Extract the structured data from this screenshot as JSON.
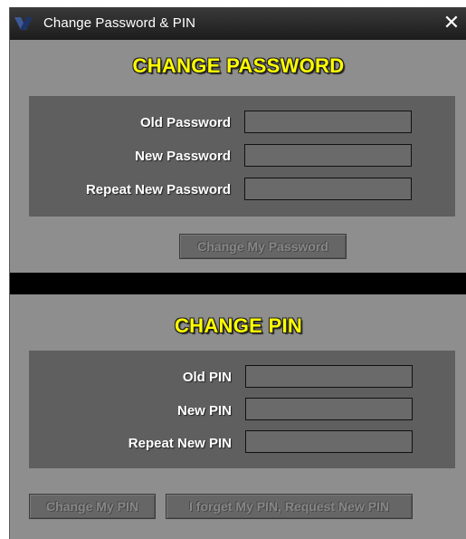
{
  "window": {
    "title": "Change Password & PIN",
    "close_symbol": "✕"
  },
  "password_section": {
    "title": "CHANGE PASSWORD",
    "fields": [
      {
        "label": "Old Password",
        "value": ""
      },
      {
        "label": "New Password",
        "value": ""
      },
      {
        "label": "Repeat New Password",
        "value": ""
      }
    ],
    "submit_label": "Change My Password"
  },
  "pin_section": {
    "title": "CHANGE PIN",
    "fields": [
      {
        "label": "Old PIN",
        "value": ""
      },
      {
        "label": "New PIN",
        "value": ""
      },
      {
        "label": "Repeat New PIN",
        "value": ""
      }
    ],
    "submit_label": "Change My PIN",
    "forgot_label": "I forget My PIN, Request New PIN"
  },
  "colors": {
    "heading": "#ffff00",
    "window_bg": "#8e8e8e",
    "panel_bg": "#5f5f5f",
    "titlebar_bg": "#1c1c1c"
  },
  "icons": {
    "app": "app-logo-icon",
    "close": "close-icon"
  }
}
